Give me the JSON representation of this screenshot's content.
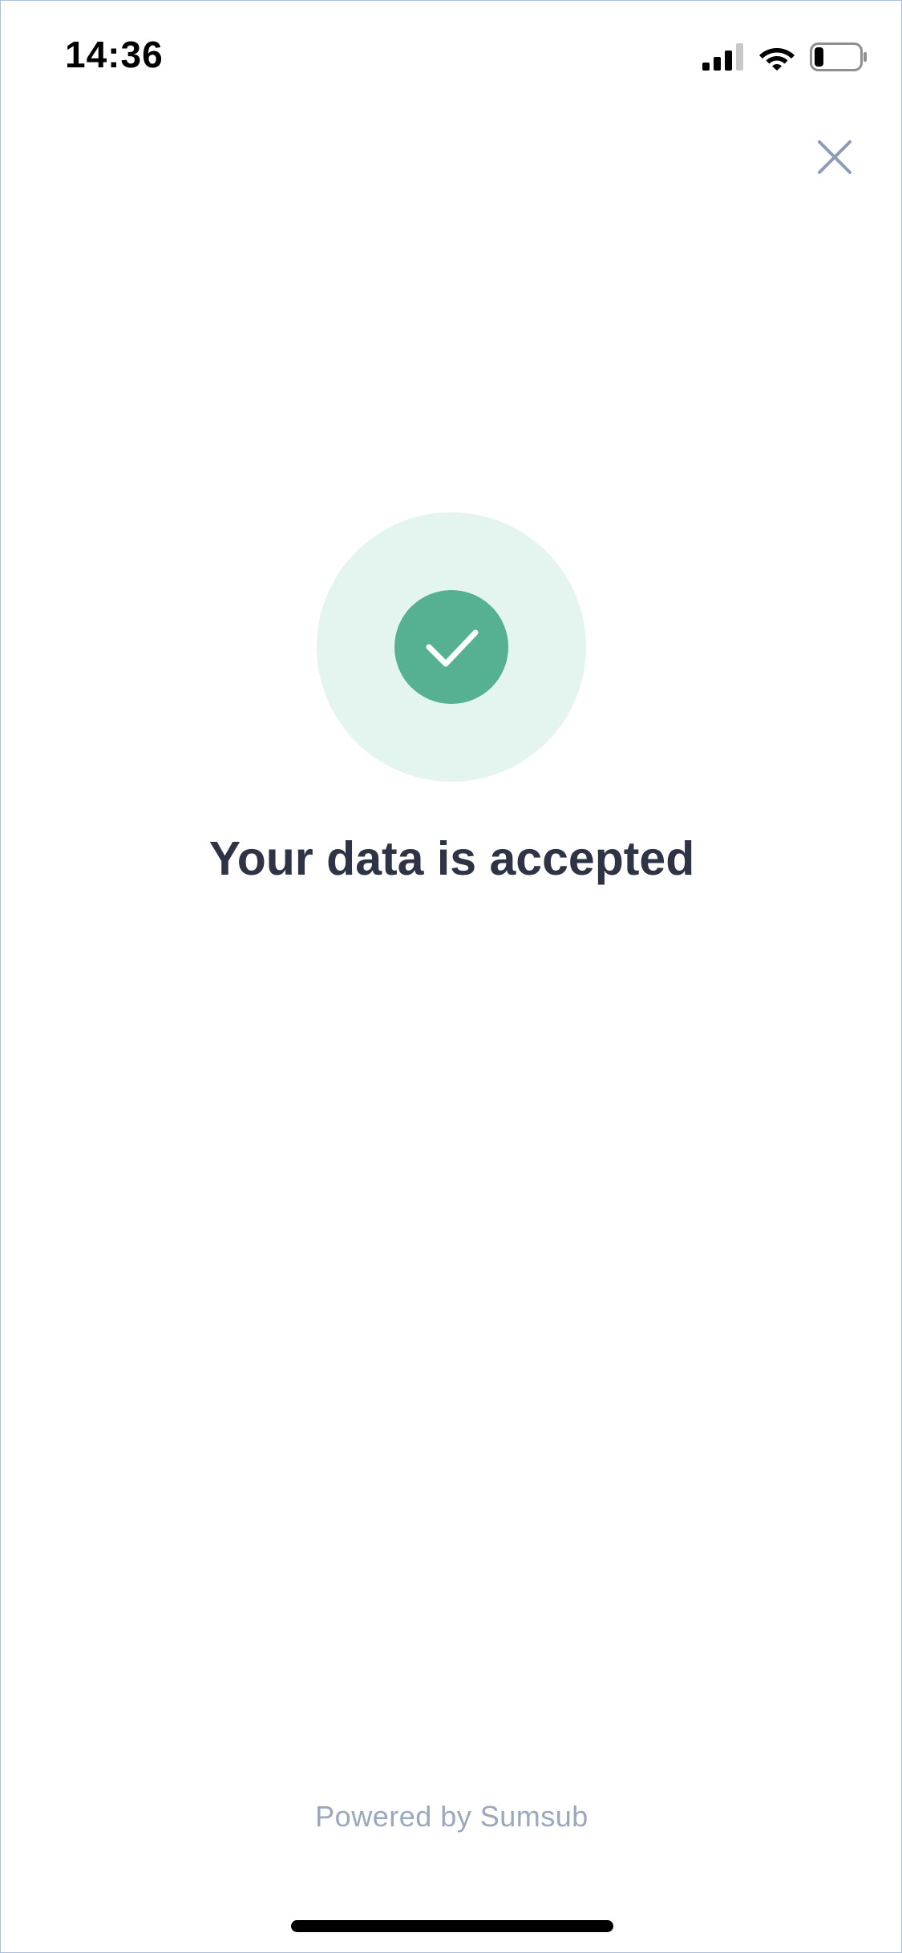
{
  "status_bar": {
    "time": "14:36",
    "icons": [
      "cellular-signal-icon",
      "wifi-icon",
      "battery-icon"
    ],
    "battery_level": 0.2
  },
  "header": {
    "close_icon": "close-icon"
  },
  "result": {
    "icon": "checkmark-icon",
    "title": "Your data is accepted",
    "accent_color": "#55b192",
    "halo_color": "#e4f4ef"
  },
  "footer": {
    "powered_by": "Powered by Sumsub"
  }
}
